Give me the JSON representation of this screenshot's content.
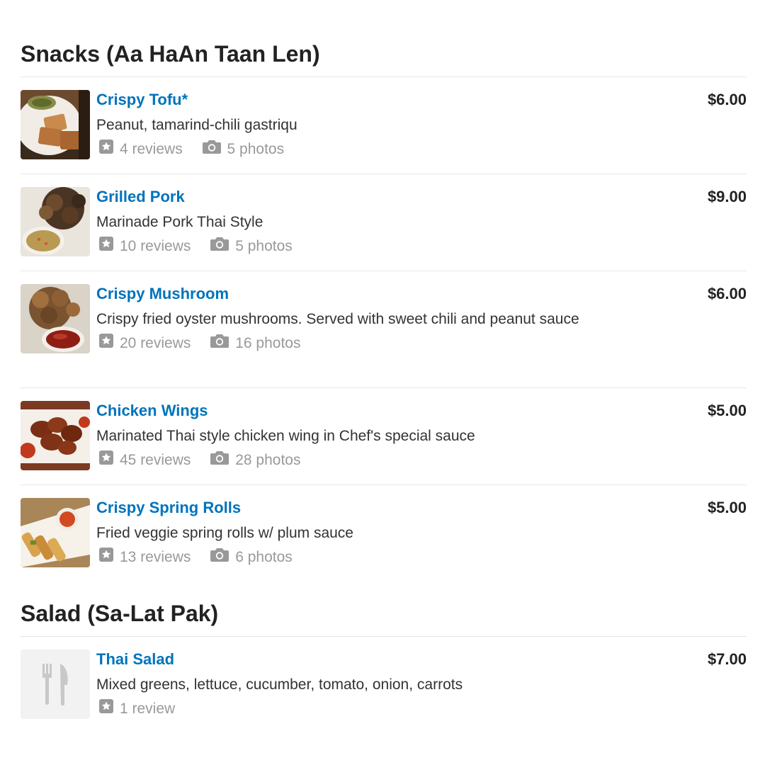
{
  "sections": [
    {
      "title": "Snacks (Aa HaAn Taan Len)",
      "items": [
        {
          "name": "Crispy Tofu*",
          "description": "Peanut, tamarind-chili gastriqu",
          "reviews": "4 reviews",
          "photos": "5 photos",
          "price": "$6.00",
          "thumb_icon": "crispy-tofu-photo"
        },
        {
          "name": "Grilled Pork",
          "description": "Marinade Pork Thai Style",
          "reviews": "10 reviews",
          "photos": "5 photos",
          "price": "$9.00",
          "thumb_icon": "grilled-pork-photo"
        },
        {
          "name": "Crispy Mushroom",
          "description": "Crispy fried oyster mushrooms. Served with sweet chili and peanut sauce",
          "reviews": "20 reviews",
          "photos": "16 photos",
          "price": "$6.00",
          "thumb_icon": "crispy-mushroom-photo"
        },
        {
          "name": "Chicken Wings",
          "description": "Marinated Thai style chicken wing in Chef's special sauce",
          "reviews": "45 reviews",
          "photos": "28 photos",
          "price": "$5.00",
          "thumb_icon": "chicken-wings-photo"
        },
        {
          "name": "Crispy Spring Rolls",
          "description": "Fried veggie spring rolls w/ plum sauce",
          "reviews": "13 reviews",
          "photos": "6 photos",
          "price": "$5.00",
          "thumb_icon": "spring-rolls-photo"
        }
      ]
    },
    {
      "title": "Salad (Sa-Lat Pak)",
      "items": [
        {
          "name": "Thai Salad",
          "description": "Mixed greens, lettuce, cucumber, tomato, onion, carrots",
          "reviews": "1 review",
          "price": "$7.00",
          "thumb_icon": "fork-knife-placeholder-icon"
        }
      ]
    }
  ],
  "colors": {
    "link": "#0073bb",
    "text": "#333333",
    "muted": "#999999",
    "divider": "#e6e6e6",
    "placeholder_bg": "#f2f2f2"
  }
}
